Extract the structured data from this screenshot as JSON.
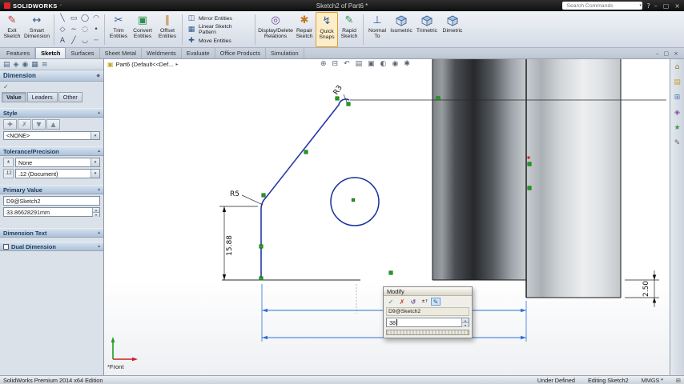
{
  "titlebar": {
    "app_name": "SOLIDWORKS",
    "doc_title": "Sketch2 of Part6 *",
    "search_placeholder": "Search Commands"
  },
  "command_bar": {
    "exit_sketch": "Exit Sketch",
    "smart_dimension": "Smart Dimension",
    "trim_entities": "Trim Entities",
    "convert_entities": "Convert Entities",
    "offset_entities": "Offset Entities",
    "mirror_entities": "Mirror Entities",
    "linear_sketch_pattern": "Linear Sketch Pattern",
    "move_entities": "Move Entities",
    "display_delete_relations": "Display/Delete Relations",
    "repair_sketch": "Repair Sketch",
    "quick_snaps": "Quick Snaps",
    "rapid_sketch": "Rapid Sketch",
    "normal_to": "Normal To",
    "isometric": "Isometric",
    "trimetric": "Trimetric",
    "dimetric": "Dimetric"
  },
  "tabs": [
    "Features",
    "Sketch",
    "Surfaces",
    "Sheet Metal",
    "Weldments",
    "Evaluate",
    "Office Products",
    "Simulation"
  ],
  "flyout_tree_label": "Part6 (Default<<Def...",
  "property_manager": {
    "title": "Dimension",
    "tabs": [
      "Value",
      "Leaders",
      "Other"
    ],
    "sections": {
      "style": "Style",
      "tolerance": "Tolerance/Precision",
      "primary_value": "Primary Value",
      "dimension_text": "Dimension Text",
      "dual_dimension": "Dual Dimension"
    },
    "style_dropdown": "<NONE>",
    "tolerance_dropdown": "None",
    "precision_dropdown": ".12 (Document)",
    "dimension_name": "D9@Sketch2",
    "dimension_value": "33.86628291mm",
    "tolerance_icon_text": "±",
    "precision_icon_text": ".12"
  },
  "viewport": {
    "view_label": "*Front",
    "dims": {
      "r3": "R3",
      "r5": "R5",
      "height": "15.88",
      "offset": "2.50"
    }
  },
  "modify": {
    "title": "Modify",
    "name": "D9@Sketch2",
    "value": "38",
    "spin_label": "±?"
  },
  "statusbar": {
    "edition": "SolidWorks Premium 2014 x64 Edition",
    "state": "Under Defined",
    "editing": "Editing Sketch2",
    "units": "MMGS"
  },
  "icons": {
    "menu_caret": "▾",
    "exit_sketch": "✎",
    "smart_dimension": "↔",
    "grid": {
      "line": "╲",
      "rectangle": "▭",
      "circle": "◯",
      "arc": "◠",
      "polygon": "◇",
      "spline": "∼",
      "ellipse": "◌",
      "point": "•",
      "text": "A",
      "centerline": "╱",
      "fillet": "◡",
      "construction": "┄"
    },
    "trim_entities": "✂",
    "convert_entities": "▣",
    "offset_entities": "∥",
    "mirror_entities": "◫",
    "linear_pattern": "▦",
    "move_entities": "✚",
    "display_relations": "◎",
    "repair_sketch": "✱",
    "quick_snaps": "↯",
    "rapid_sketch": "✎",
    "normal_to": "⊥",
    "pm_tab_icons": [
      "▤",
      "◈",
      "◉",
      "▦",
      "≡"
    ],
    "ok_check": "✓",
    "pin": "◆",
    "collapse": "▴",
    "dropdown": "▾",
    "spin_up": "▴",
    "spin_down": "▾",
    "modify_ok": "✓",
    "modify_cancel": "✗",
    "modify_rebuild": "↺",
    "modify_mark": "✎",
    "win_min": "–",
    "win_restore": "▢",
    "win_close": "×",
    "help": "?",
    "flyout_caret": "▸",
    "hud_icons": [
      "⊕",
      "⊟",
      "↶",
      "▤",
      "▣",
      "◐",
      "◉",
      "✱"
    ],
    "task_pane_icons": [
      "⌂",
      "▤",
      "⊞",
      "◈",
      "★",
      "✎"
    ],
    "status_icon": "⊞"
  },
  "colors": {
    "sketch_blue": "#2638a8",
    "selection_blue": "#2f6fd6",
    "point_green": "#1ca21c",
    "highlight_orange": "#e39b2d",
    "titlebar_dark": "#141414"
  }
}
